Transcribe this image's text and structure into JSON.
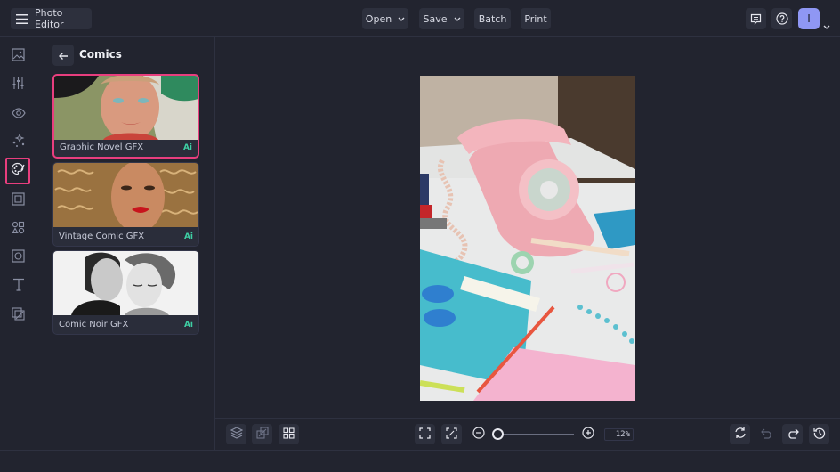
{
  "header": {
    "menu_icon": "hamburger-menu-icon",
    "app_title": "Photo Editor",
    "menu": [
      {
        "label": "Open",
        "has_dropdown": true
      },
      {
        "label": "Save",
        "has_dropdown": true
      },
      {
        "label": "Batch",
        "has_dropdown": false
      },
      {
        "label": "Print",
        "has_dropdown": false
      }
    ],
    "right_icons": [
      "feedback-icon",
      "help-icon"
    ],
    "avatar_initial": "I",
    "avatar_color": "#8f97f4"
  },
  "sidebar": {
    "items": [
      {
        "name": "image",
        "icon": "image-icon",
        "active": false
      },
      {
        "name": "adjustments",
        "icon": "sliders-icon",
        "active": false
      },
      {
        "name": "effects",
        "icon": "eye-icon",
        "active": false
      },
      {
        "name": "ai-tools",
        "icon": "sparkles-icon",
        "active": false
      },
      {
        "name": "artsy",
        "icon": "palette-icon",
        "active": true
      },
      {
        "name": "frames",
        "icon": "frame-icon",
        "active": false
      },
      {
        "name": "graphics",
        "icon": "shapes-icon",
        "active": false
      },
      {
        "name": "overlays",
        "icon": "overlay-icon",
        "active": false
      },
      {
        "name": "text",
        "icon": "text-icon",
        "active": false
      },
      {
        "name": "layers-bg",
        "icon": "background-icon",
        "active": false
      }
    ],
    "accent_color": "#e83e7e"
  },
  "panel": {
    "back_icon": "arrow-left-icon",
    "title": "Comics",
    "cards": [
      {
        "label": "Graphic Novel GFX",
        "badge": "Ai",
        "selected": true
      },
      {
        "label": "Vintage Comic GFX",
        "badge": "Ai",
        "selected": false
      },
      {
        "label": "Comic Noir GFX",
        "badge": "Ai",
        "selected": false
      }
    ],
    "badge_color": "#3ecfa4"
  },
  "canvas": {
    "image_description": "Pink rotary telephone on desk with stationery, teal notebook, scissors and pens"
  },
  "bottom_toolbar": {
    "left_icons": [
      "layers-icon",
      "duplicate-icon",
      "grid-icon"
    ],
    "center_icons": [
      "fit-screen-icon",
      "actual-size-icon",
      "zoom-out-icon",
      "zoom-in-icon"
    ],
    "zoom_level": "12%",
    "zoom_value_percent": 12,
    "right_icons": [
      "reset-icon",
      "undo-icon",
      "redo-icon",
      "history-icon"
    ]
  }
}
